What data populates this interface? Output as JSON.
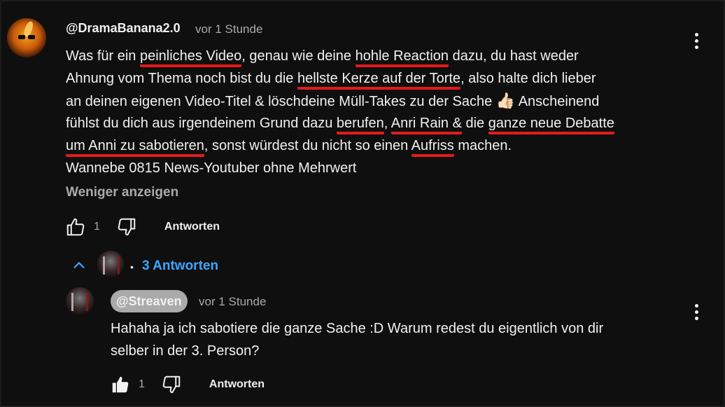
{
  "comment": {
    "author": "@DramaBanana2.0",
    "time": "vor 1 Stunde",
    "segments": {
      "l1a": "Was für ein ",
      "l1b": "peinliches Video",
      "l1c": ", genau wie deine ",
      "l1d": "hohle Reaction",
      "l1e": " dazu, du hast weder",
      "l2a": "Ahnung vom Thema noch bist du die ",
      "l2b": "hellste Kerze auf der Torte",
      "l2c": ", also halte dich lieber",
      "l3a": "an deinen eigenen Video-Titel & löschdeine Müll-Takes zu der Sache ",
      "l3emoji": "👍🏻",
      "l3b": " Anscheinend",
      "l4a": "fühlst du dich aus irgendeinem Grund dazu ",
      "l4b": "berufen",
      "l4c": ", ",
      "l4d": "Anri Rain &",
      "l4e": " die ",
      "l4f": "ganze neue Debatte",
      "l5a": "um Anni zu sabotieren",
      "l5b": ", sonst würdest du nicht so einen ",
      "l5c": "Aufriss",
      "l5d": " machen.",
      "l6": "Wannebe 0815 News-Youtuber ohne Mehrwert"
    },
    "show_less": "Weniger anzeigen",
    "likes": "1",
    "reply_label": "Antworten"
  },
  "thread": {
    "replies_label": "3 Antworten",
    "separator": "•"
  },
  "reply": {
    "author": "@Streaven",
    "time": "vor 1 Stunde",
    "text_line1": "Hahaha ja ich sabotiere die ganze Sache :D Warum redest du eigentlich von dir",
    "text_line2": "selber in der 3. Person?",
    "likes": "1",
    "reply_label": "Antworten"
  },
  "colors": {
    "background": "#0f0f0f",
    "text": "#f1f1f1",
    "secondary": "#aaaaaa",
    "link_blue": "#3ea6ff",
    "annotation_red": "#e21b1b"
  },
  "icons": {
    "like": "thumbs-up-outline-icon",
    "like_filled": "thumbs-up-filled-icon",
    "dislike": "thumbs-down-outline-icon",
    "menu": "more-vert-icon",
    "collapse": "chevron-up-icon"
  }
}
